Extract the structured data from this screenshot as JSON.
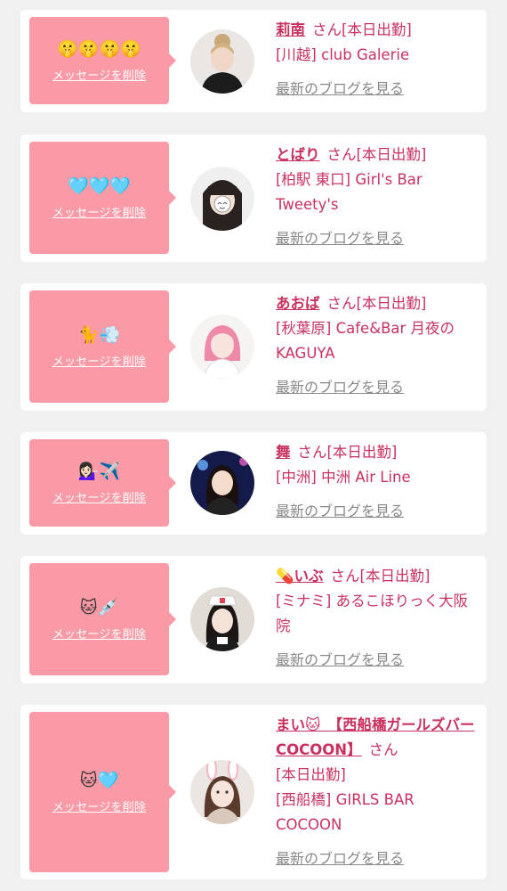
{
  "entries": [
    {
      "emoji": "🤫🤫🤫🤫",
      "delete_label": "メッセージを削除",
      "name": "莉南",
      "honorific": "さん",
      "status": "[本日出勤]",
      "shop": "[川越] club Galerie",
      "blog_label": "最新のブログを見る",
      "avatar_desc": "woman-hair-bun"
    },
    {
      "emoji": "🩵🩵🩵",
      "delete_label": "メッセージを削除",
      "name": "とばり",
      "honorific": "さん",
      "status": "[本日出勤]",
      "shop": "[柏駅 東口] Girl's Bar Tweety's",
      "blog_label": "最新のブログを見る",
      "avatar_desc": "dark-hair-smiley"
    },
    {
      "emoji": "🐈💨",
      "delete_label": "メッセージを削除",
      "name": "あおば",
      "honorific": "さん",
      "status": "[本日出勤]",
      "shop": "[秋葉原] Cafe&Bar 月夜のKAGUYA",
      "blog_label": "最新のブログを見る",
      "avatar_desc": "pink-hair"
    },
    {
      "emoji": "💁🏻‍♀️✈️",
      "delete_label": "メッセージを削除",
      "name": "舞",
      "honorific": "さん",
      "status": "[本日出勤]",
      "shop": "[中洲] 中洲 Air Line",
      "blog_label": "最新のブログを見る",
      "avatar_desc": "stage-lights"
    },
    {
      "emoji": "🐱💉",
      "delete_label": "メッセージを削除",
      "name": "💊いぶ",
      "honorific": "さん",
      "status": "[本日出勤]",
      "shop": "[ミナミ] あるこほりっく大阪院",
      "blog_label": "最新のブログを見る",
      "avatar_desc": "nurse-cap"
    },
    {
      "emoji": "🐱🩵",
      "delete_label": "メッセージを削除",
      "name": "まい🐱　【西船橋ガールズバーCOCOON】",
      "honorific": "さん",
      "status": "[本日出勤]",
      "shop": "[西船橋] GIRLS BAR COCOON",
      "blog_label": "最新のブログを見る",
      "avatar_desc": "bunny-ears"
    }
  ]
}
